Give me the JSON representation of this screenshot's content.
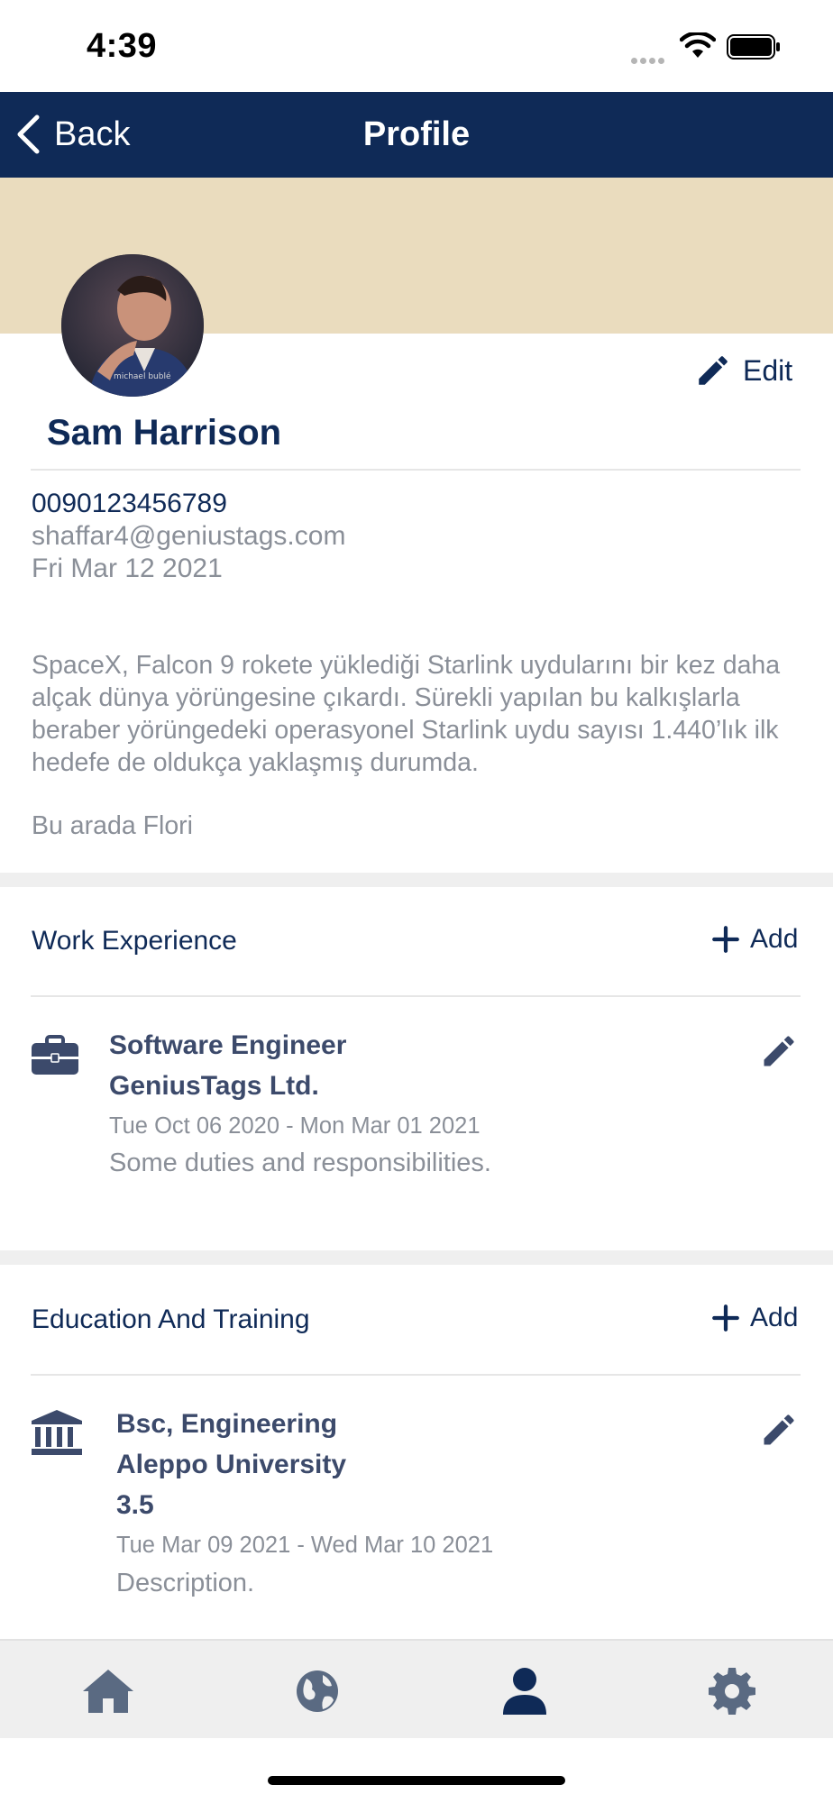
{
  "status_bar": {
    "time": "4:39"
  },
  "nav": {
    "back_label": "Back",
    "title": "Profile"
  },
  "profile": {
    "avatar_caption": "michael bublé",
    "edit_label": "Edit",
    "name": "Sam Harrison",
    "phone": "0090123456789",
    "email": "shaffar4@geniustags.com",
    "date": "Fri Mar 12 2021",
    "bio": "SpaceX, Falcon 9 rokete yüklediği Starlink uydularını bir kez daha alçak dünya yörüngesine çıkardı. Sürekli yapılan bu kalkışlarla beraber yörüngedeki operasyonel Starlink uydu sayısı 1.440’lık ilk hedefe de oldukça yaklaşmış durumda.",
    "bio_extra": "Bu arada Flori"
  },
  "work": {
    "title": "Work Experience",
    "add_label": "Add",
    "items": [
      {
        "position": "Software Engineer",
        "company": "GeniusTags Ltd.",
        "dates": "Tue Oct 06 2020 - Mon Mar 01 2021",
        "description": "Some duties and responsibilities."
      }
    ]
  },
  "education": {
    "title": "Education And Training",
    "add_label": "Add",
    "items": [
      {
        "degree": "Bsc, Engineering",
        "institution": "Aleppo University",
        "grade": "3.5",
        "dates": "Tue Mar 09 2021 - Wed Mar 10 2021",
        "description": "Description."
      }
    ]
  },
  "tab_bar": {
    "tabs": [
      {
        "icon": "home-icon",
        "active": false
      },
      {
        "icon": "globe-icon",
        "active": false
      },
      {
        "icon": "user-icon",
        "active": true
      },
      {
        "icon": "gear-icon",
        "active": false
      }
    ]
  },
  "colors": {
    "primary": "#0f2a57",
    "cover": "#eadcbe",
    "muted_text": "#8a8f98",
    "icon_inactive": "#5a6a82"
  }
}
